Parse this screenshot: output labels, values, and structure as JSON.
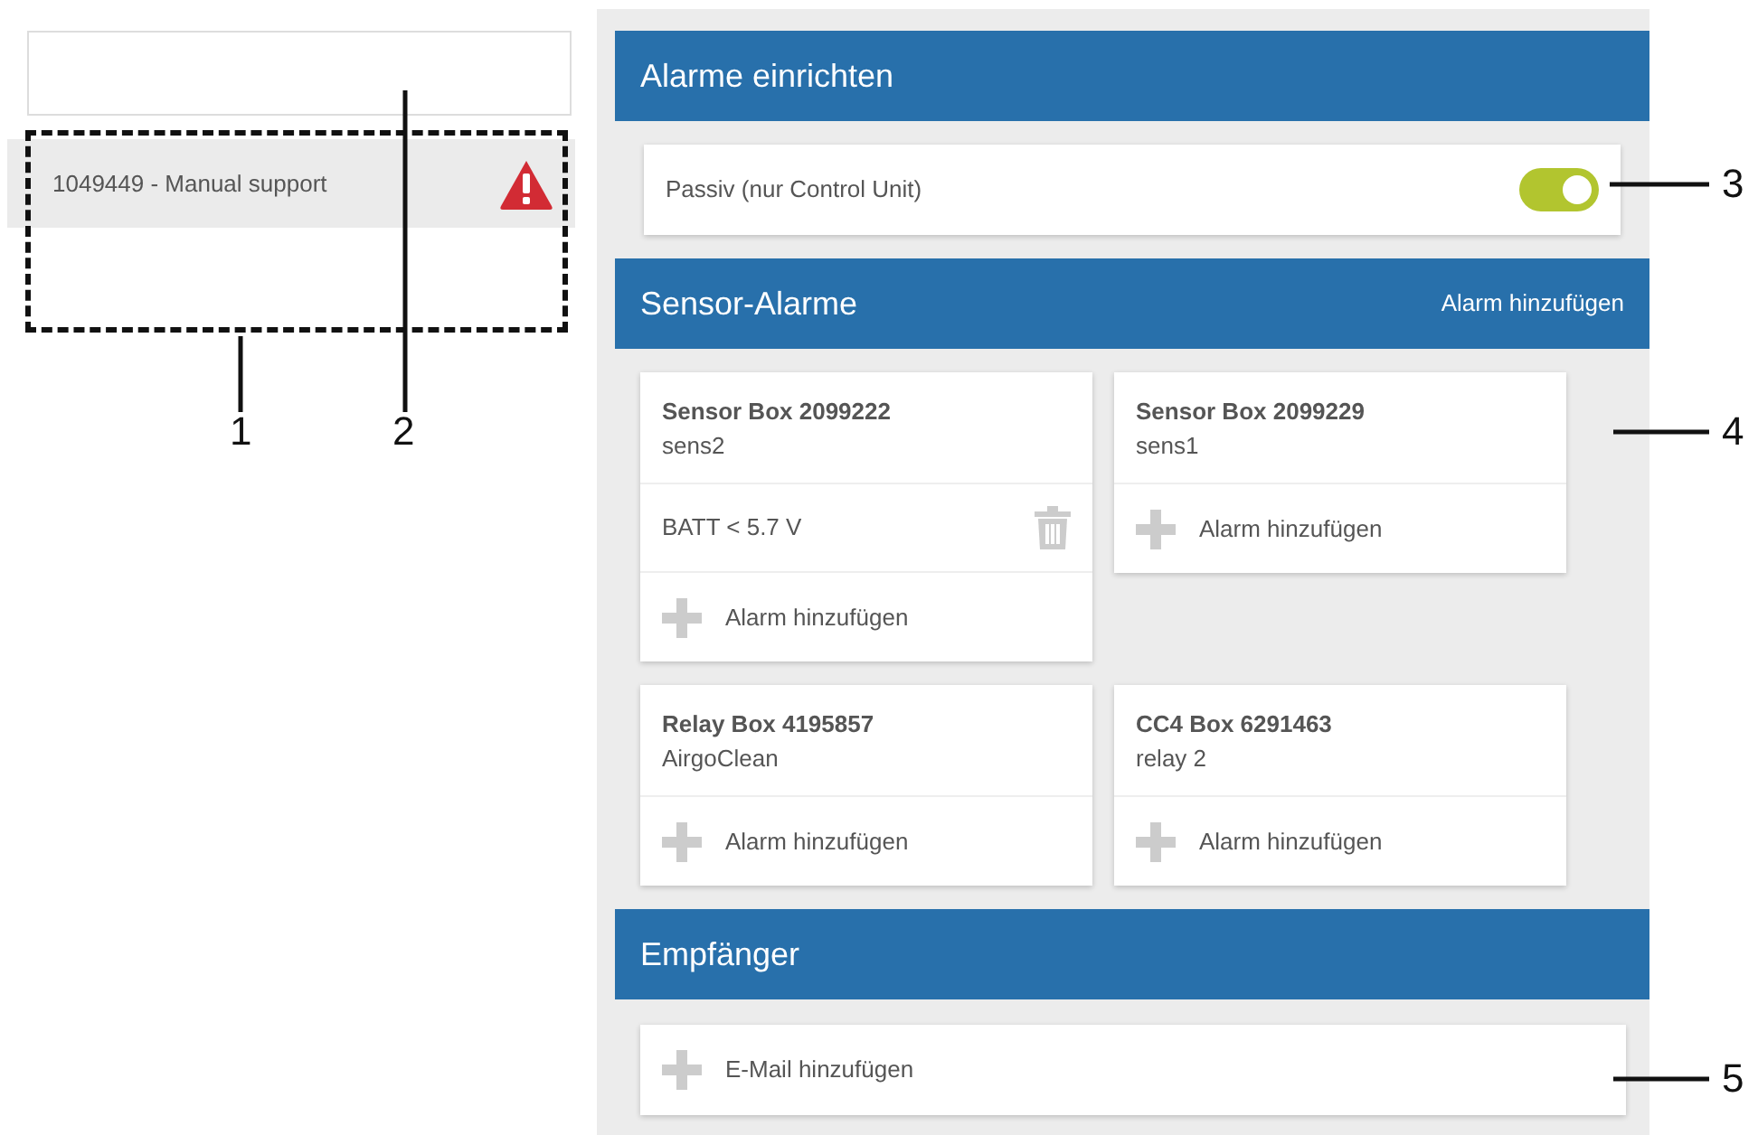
{
  "sidebar": {
    "items": [
      {
        "label": "1049449 - Manual support",
        "selected": true,
        "warning": true
      }
    ]
  },
  "sections": [
    {
      "kind": "toggle",
      "title": "Alarme einrichten",
      "label": "Passiv (nur Control Unit)",
      "on": true
    },
    {
      "kind": "devices",
      "title": "Sensor-Alarme",
      "action": "Alarm hinzufügen",
      "devices": [
        {
          "name": "Sensor Box 2099222",
          "subtitle": "sens2",
          "alarms": [
            "BATT < 5.7 V"
          ],
          "add_label": "Alarm hinzufügen"
        },
        {
          "name": "Sensor Box 2099229",
          "subtitle": "sens1",
          "add_label": "Alarm hinzufügen"
        },
        {
          "name": "Relay Box 4195857",
          "subtitle": "AirgoClean",
          "add_label": "Alarm hinzufügen"
        },
        {
          "name": "CC4 Box 6291463",
          "subtitle": "relay 2",
          "add_label": "Alarm hinzufügen"
        }
      ]
    },
    {
      "kind": "recipients",
      "title": "Empfänger",
      "add_label": "E-Mail hinzufügen"
    }
  ],
  "callouts": [
    {
      "label": "1"
    },
    {
      "label": "2"
    },
    {
      "label": "3"
    },
    {
      "label": "4"
    },
    {
      "label": "5"
    }
  ]
}
